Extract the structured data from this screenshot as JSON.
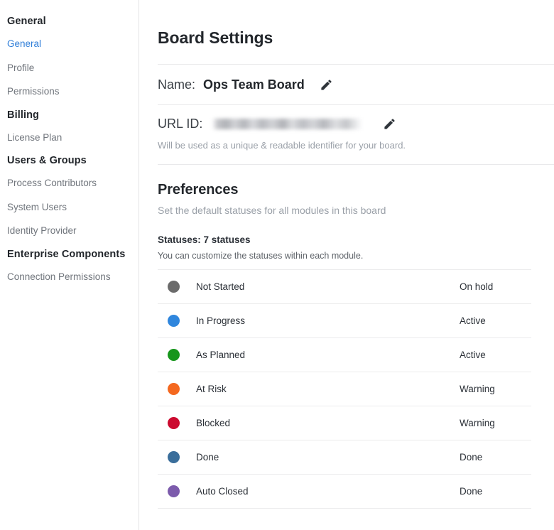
{
  "sidebar": {
    "groups": [
      {
        "title": "General",
        "items": [
          {
            "label": "General",
            "active": true
          },
          {
            "label": "Profile",
            "active": false
          },
          {
            "label": "Permissions",
            "active": false
          }
        ]
      },
      {
        "title": "Billing",
        "items": [
          {
            "label": "License Plan",
            "active": false
          }
        ]
      },
      {
        "title": "Users & Groups",
        "items": [
          {
            "label": "Process Contributors",
            "active": false
          },
          {
            "label": "System Users",
            "active": false
          },
          {
            "label": "Identity Provider",
            "active": false
          }
        ]
      },
      {
        "title": "Enterprise Components",
        "items": [
          {
            "label": "Connection Permissions",
            "active": false
          }
        ]
      }
    ]
  },
  "main": {
    "page_title": "Board Settings",
    "name_field": {
      "label": "Name:",
      "value": "Ops Team Board",
      "edit_icon": "pencil-icon"
    },
    "url_id_field": {
      "label": "URL ID:",
      "value": "",
      "redacted": true,
      "hint": "Will be used as a unique & readable identifier for your board.",
      "edit_icon": "pencil-icon"
    },
    "preferences": {
      "title": "Preferences",
      "subtitle": "Set the default statuses for all modules in this board",
      "statuses_heading": "Statuses: 7 statuses",
      "statuses_note": "You can customize the statuses within each module.",
      "statuses": [
        {
          "name": "Not Started",
          "kind": "On hold",
          "color": "#6b6b6b"
        },
        {
          "name": "In Progress",
          "kind": "Active",
          "color": "#2f86dd"
        },
        {
          "name": "As Planned",
          "kind": "Active",
          "color": "#17961c"
        },
        {
          "name": "At Risk",
          "kind": "Warning",
          "color": "#f4681f"
        },
        {
          "name": "Blocked",
          "kind": "Warning",
          "color": "#cc0a2f"
        },
        {
          "name": "Done",
          "kind": "Done",
          "color": "#3a6e9b"
        },
        {
          "name": "Auto Closed",
          "kind": "Done",
          "color": "#7c5bac"
        }
      ]
    }
  },
  "colors": {
    "accent": "#2f7ed8",
    "text_primary": "#23272c",
    "text_muted": "#9aa0a8",
    "border": "#e9e9eb"
  }
}
